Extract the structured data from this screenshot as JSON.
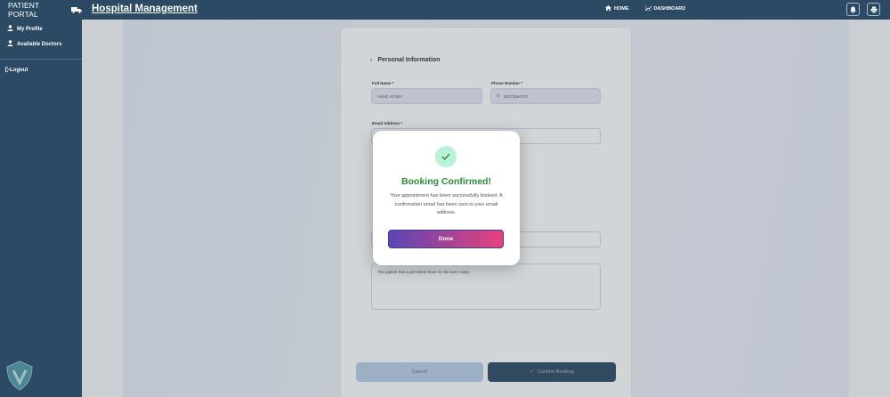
{
  "header": {
    "brand": "PATIENT PORTAL",
    "title": "Hospital Management",
    "nav": [
      {
        "label": "HOME",
        "icon": "home-icon"
      },
      {
        "label": "DASHBOARD",
        "icon": "chart-icon"
      }
    ]
  },
  "sidebar": {
    "items": [
      {
        "label": "My Profile",
        "icon": "user-icon"
      },
      {
        "label": "Available Doctors",
        "icon": "user-icon"
      }
    ],
    "logout": "Logout"
  },
  "form": {
    "section_title": "Personal Information",
    "full_name_label": "Full Name *",
    "full_name_value": "ASAD AYUBY",
    "phone_label": "Phone Number *",
    "phone_value": "03172844707",
    "email_label": "Email Address *",
    "notes_text": "The patient has a persistent fever for the last 2 days",
    "cancel_label": "Cancel",
    "confirm_label": "Confirm Booking"
  },
  "modal": {
    "title": "Booking Confirmed!",
    "message": "Your appointment has been successfully booked. A confirmation email has been sent to your email address.",
    "done_label": "Done"
  },
  "colors": {
    "primary": "#2c4a63",
    "success": "#2e8a38",
    "gradient_start": "#5b46b3",
    "gradient_end": "#e8417d"
  }
}
